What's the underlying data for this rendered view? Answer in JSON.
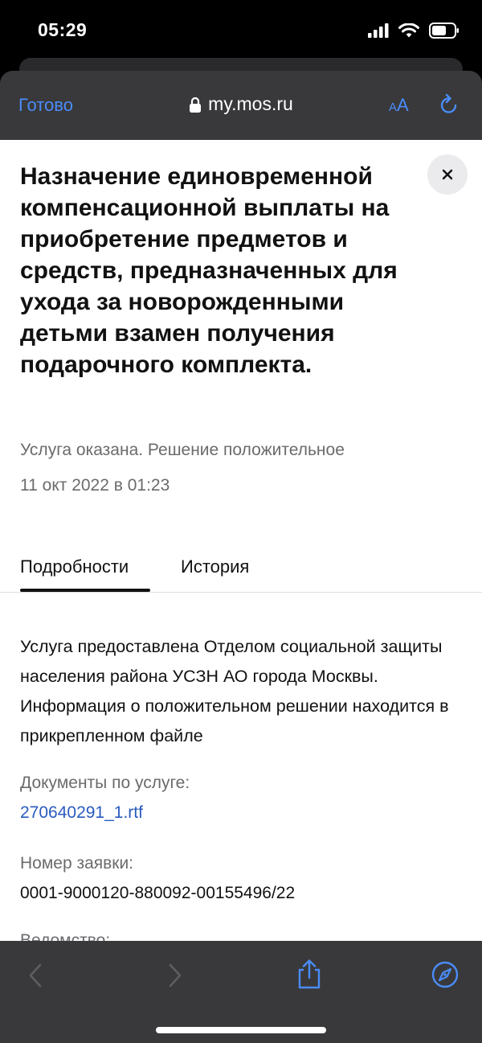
{
  "status_bar": {
    "time": "05:29",
    "icons": [
      "signal-icon",
      "wifi-icon",
      "battery-icon"
    ]
  },
  "browser": {
    "done_label": "Готово",
    "url": "my.mos.ru",
    "text_size_small": "A",
    "text_size_large": "A",
    "icons": [
      "lock-icon",
      "reload-icon"
    ]
  },
  "page": {
    "title": "Назначение единовременной компенсационной выплаты на приобретение предметов и средств, предназначенных для ухода за новорожденными детьми взамен получения подарочного комплекта.",
    "status": "Услуга оказана. Решение положительное",
    "date": "11 окт 2022 в 01:23",
    "tabs": [
      {
        "label": "Подробности",
        "active": true
      },
      {
        "label": "История",
        "active": false
      }
    ],
    "description": "Услуга предоставлена Отделом социальной защиты населения района УСЗН АО города Москвы. Информация о положительном решении находится в прикрепленном файле",
    "documents_label": "Документы по услуге:",
    "document_link": "270640291_1.rtf",
    "request_number_label": "Номер заявки:",
    "request_number": "0001-9000120-880092-00155496/22",
    "cut_off_label": "Ведомство:"
  },
  "toolbar": {
    "icons": [
      "back-icon",
      "forward-icon",
      "share-icon",
      "compass-icon"
    ]
  },
  "colors": {
    "accent": "#4a8cf7",
    "link": "#2a5bbf",
    "bar_bg": "#39393b",
    "muted_text": "#6b6b6e"
  }
}
